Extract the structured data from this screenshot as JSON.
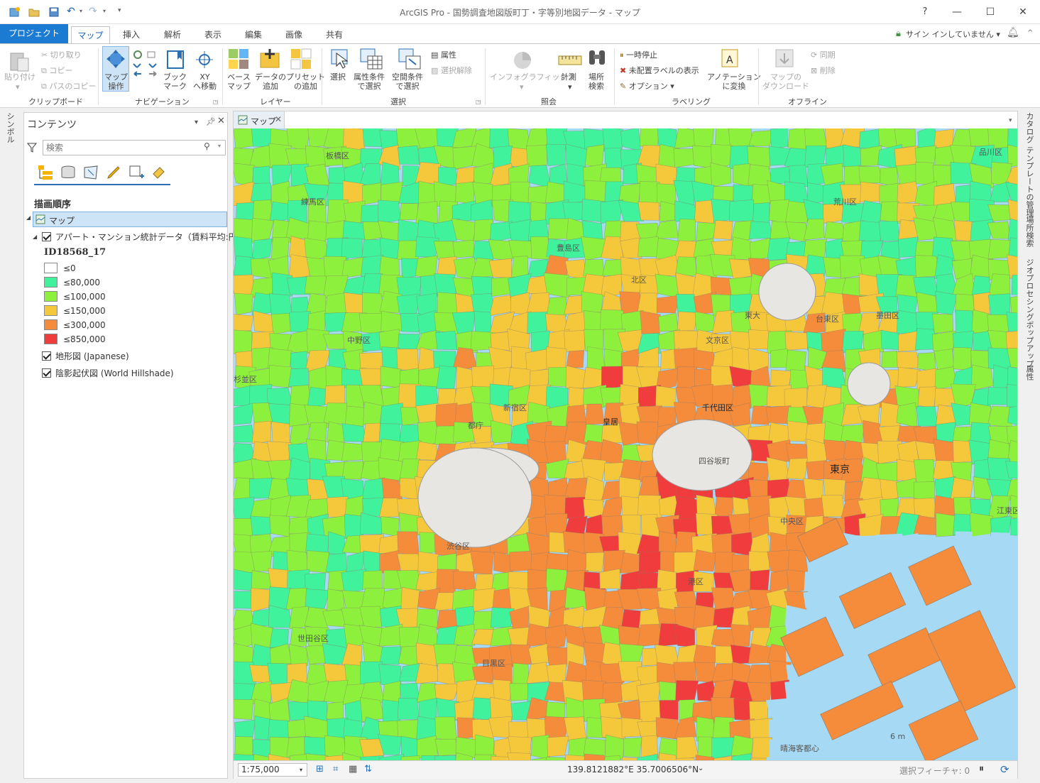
{
  "app": {
    "title": "ArcGIS Pro - 国勢調査地図版町丁・字等別地図データ - マップ",
    "help": "?",
    "sign_in": "サイン インしていません"
  },
  "tabs": [
    "プロジェクト",
    "マップ",
    "挿入",
    "解析",
    "表示",
    "編集",
    "画像",
    "共有"
  ],
  "ribbon": {
    "clipboard": {
      "label": "クリップボード",
      "paste": "貼り付け",
      "cut": "切り取り",
      "copy": "コピー",
      "copy_path": "パスのコピー"
    },
    "navigation": {
      "label": "ナビゲーション",
      "explore": "マップ\n操作",
      "bookmarks": "ブック\nマーク",
      "goto_xy": "XY\nへ移動"
    },
    "layer": {
      "label": "レイヤー",
      "basemap": "ベース\nマップ",
      "add_data": "データの\n追加",
      "add_preset": "プリセット\nの追加"
    },
    "selection": {
      "label": "選択",
      "select": "選択",
      "by_attributes": "属性条件\nで選択",
      "by_location": "空間条件\nで選択",
      "attributes": "属性",
      "clear": "選択解除"
    },
    "inquiry": {
      "label": "照会",
      "infographics": "インフォグラフィックス",
      "measure": "計測",
      "locate": "場所\n検索"
    },
    "labeling": {
      "label": "ラベリング",
      "pause": "一時停止",
      "unplaced": "未配置ラベルの表示",
      "options": "オプション",
      "convert": "アノテーション\nに変換"
    },
    "offline": {
      "label": "オフライン",
      "download": "マップの\nダウンロード",
      "sync": "同期",
      "remove": "削除"
    }
  },
  "left_strip": "シンボル",
  "contents": {
    "title": "コンテンツ",
    "search_placeholder": "検索",
    "drawing_order": "描画順序",
    "map_node": "マップ",
    "layer_name": "アパート・マンション統計データ（賃料平均:円）",
    "field": "ID18568_17",
    "legend": [
      {
        "label": "≤0",
        "color": "#ffffff"
      },
      {
        "label": "≤80,000",
        "color": "#3ff29b"
      },
      {
        "label": "≤100,000",
        "color": "#8cf03c"
      },
      {
        "label": "≤150,000",
        "color": "#f5c83c"
      },
      {
        "label": "≤300,000",
        "color": "#f58c3c"
      },
      {
        "label": "≤850,000",
        "color": "#f03c3c"
      }
    ],
    "basemaps": [
      "地形図 (Japanese)",
      "陰影起伏図 (World Hillshade)"
    ]
  },
  "map": {
    "tab": "マップ",
    "scale": "1:75,000",
    "coordinates": "139.8121882°E 35.7006506°N",
    "selected_features": "選択フィーチャ: 0",
    "labels": [
      "板橋区",
      "練馬区",
      "豊島区",
      "荒川区",
      "北区",
      "東大",
      "台東区",
      "墨田区",
      "文京区",
      "中野区",
      "杉並区",
      "新宿区",
      "都庁",
      "千代田区",
      "皇居",
      "四谷坂町",
      "東京",
      "中央区",
      "江東区",
      "港区",
      "渋谷区",
      "目黒区",
      "世田谷区",
      "品川区",
      "晴海客都心",
      "6 m"
    ]
  },
  "right_strip": [
    "カタログ",
    "テンプレートの管理",
    "場所検索",
    "ジオプロセシング",
    "ポップアップ",
    "属性"
  ]
}
